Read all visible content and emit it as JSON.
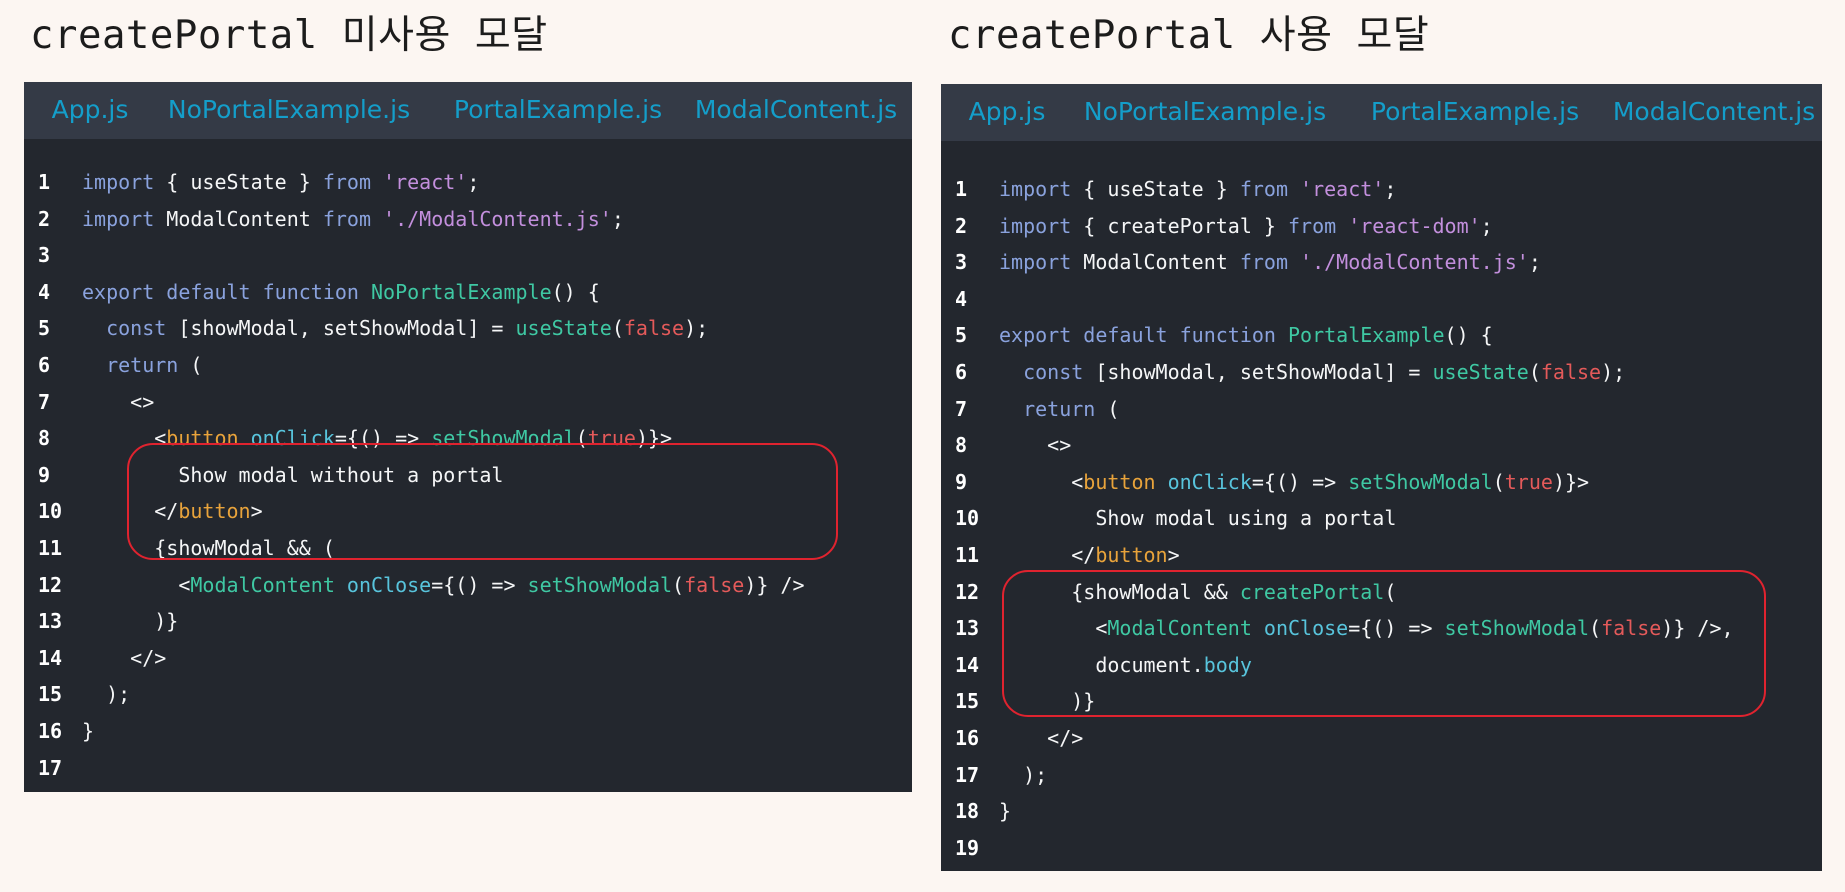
{
  "left": {
    "heading": "createPortal 미사용 모달",
    "tabs": [
      {
        "label": "App.js",
        "active": false
      },
      {
        "label": "NoPortalExample.js",
        "active": true
      },
      {
        "label": "PortalExample.js",
        "active": false
      },
      {
        "label": "ModalContent.js",
        "active": false
      }
    ],
    "lines": [
      {
        "n": "1",
        "tokens": [
          [
            "k",
            "import"
          ],
          [
            "p",
            " { useState } "
          ],
          [
            "k",
            "from"
          ],
          [
            "p",
            " "
          ],
          [
            "s",
            "'react'"
          ],
          [
            "p",
            ";"
          ]
        ]
      },
      {
        "n": "2",
        "tokens": [
          [
            "k",
            "import"
          ],
          [
            "p",
            " ModalContent "
          ],
          [
            "k",
            "from"
          ],
          [
            "p",
            " "
          ],
          [
            "s",
            "'./ModalContent.js'"
          ],
          [
            "p",
            ";"
          ]
        ]
      },
      {
        "n": "3",
        "tokens": []
      },
      {
        "n": "4",
        "tokens": [
          [
            "k",
            "export default function"
          ],
          [
            "p",
            " "
          ],
          [
            "fn",
            "NoPortalExample"
          ],
          [
            "p",
            "() {"
          ]
        ]
      },
      {
        "n": "5",
        "tokens": [
          [
            "p",
            "  "
          ],
          [
            "k",
            "const"
          ],
          [
            "p",
            " [showModal, setShowModal] = "
          ],
          [
            "fn",
            "useState"
          ],
          [
            "p",
            "("
          ],
          [
            "b",
            "false"
          ],
          [
            "p",
            ");"
          ]
        ]
      },
      {
        "n": "6",
        "tokens": [
          [
            "p",
            "  "
          ],
          [
            "k",
            "return"
          ],
          [
            "p",
            " ("
          ]
        ]
      },
      {
        "n": "7",
        "tokens": [
          [
            "p",
            "    <>"
          ]
        ]
      },
      {
        "n": "8",
        "tokens": [
          [
            "p",
            "      <"
          ],
          [
            "t",
            "button"
          ],
          [
            "p",
            " "
          ],
          [
            "a",
            "onClick"
          ],
          [
            "p",
            "={() => "
          ],
          [
            "fn",
            "setShowModal"
          ],
          [
            "p",
            "("
          ],
          [
            "b",
            "true"
          ],
          [
            "p",
            ")}>"
          ]
        ]
      },
      {
        "n": "9",
        "tokens": [
          [
            "p",
            "        Show modal without a portal"
          ]
        ]
      },
      {
        "n": "10",
        "tokens": [
          [
            "p",
            "      </"
          ],
          [
            "t",
            "button"
          ],
          [
            "p",
            ">"
          ]
        ]
      },
      {
        "n": "11",
        "tokens": [
          [
            "p",
            "      {showModal && ("
          ]
        ]
      },
      {
        "n": "12",
        "tokens": [
          [
            "p",
            "        <"
          ],
          [
            "fn",
            "ModalContent"
          ],
          [
            "p",
            " "
          ],
          [
            "a",
            "onClose"
          ],
          [
            "p",
            "={() => "
          ],
          [
            "fn",
            "setShowModal"
          ],
          [
            "p",
            "("
          ],
          [
            "b",
            "false"
          ],
          [
            "p",
            ")} />"
          ]
        ]
      },
      {
        "n": "13",
        "tokens": [
          [
            "p",
            "      )}"
          ]
        ]
      },
      {
        "n": "14",
        "tokens": [
          [
            "p",
            "    </>"
          ]
        ]
      },
      {
        "n": "15",
        "tokens": [
          [
            "p",
            "  );"
          ]
        ]
      },
      {
        "n": "16",
        "tokens": [
          [
            "p",
            "}"
          ]
        ]
      },
      {
        "n": "17",
        "tokens": []
      }
    ]
  },
  "right": {
    "heading": "createPortal 사용 모달",
    "tabs": [
      {
        "label": "App.js",
        "active": false
      },
      {
        "label": "NoPortalExample.js",
        "active": false
      },
      {
        "label": "PortalExample.js",
        "active": true
      },
      {
        "label": "ModalContent.js",
        "active": false
      }
    ],
    "lines": [
      {
        "n": "1",
        "tokens": [
          [
            "k",
            "import"
          ],
          [
            "p",
            " { useState } "
          ],
          [
            "k",
            "from"
          ],
          [
            "p",
            " "
          ],
          [
            "s",
            "'react'"
          ],
          [
            "p",
            ";"
          ]
        ]
      },
      {
        "n": "2",
        "tokens": [
          [
            "k",
            "import"
          ],
          [
            "p",
            " { createPortal } "
          ],
          [
            "k",
            "from"
          ],
          [
            "p",
            " "
          ],
          [
            "s",
            "'react-dom'"
          ],
          [
            "p",
            ";"
          ]
        ]
      },
      {
        "n": "3",
        "tokens": [
          [
            "k",
            "import"
          ],
          [
            "p",
            " ModalContent "
          ],
          [
            "k",
            "from"
          ],
          [
            "p",
            " "
          ],
          [
            "s",
            "'./ModalContent.js'"
          ],
          [
            "p",
            ";"
          ]
        ]
      },
      {
        "n": "4",
        "tokens": []
      },
      {
        "n": "5",
        "tokens": [
          [
            "k",
            "export default function"
          ],
          [
            "p",
            " "
          ],
          [
            "fn",
            "PortalExample"
          ],
          [
            "p",
            "() {"
          ]
        ]
      },
      {
        "n": "6",
        "tokens": [
          [
            "p",
            "  "
          ],
          [
            "k",
            "const"
          ],
          [
            "p",
            " [showModal, setShowModal] = "
          ],
          [
            "fn",
            "useState"
          ],
          [
            "p",
            "("
          ],
          [
            "b",
            "false"
          ],
          [
            "p",
            ");"
          ]
        ]
      },
      {
        "n": "7",
        "tokens": [
          [
            "p",
            "  "
          ],
          [
            "k",
            "return"
          ],
          [
            "p",
            " ("
          ]
        ]
      },
      {
        "n": "8",
        "tokens": [
          [
            "p",
            "    <>"
          ]
        ]
      },
      {
        "n": "9",
        "tokens": [
          [
            "p",
            "      <"
          ],
          [
            "t",
            "button"
          ],
          [
            "p",
            " "
          ],
          [
            "a",
            "onClick"
          ],
          [
            "p",
            "={() => "
          ],
          [
            "fn",
            "setShowModal"
          ],
          [
            "p",
            "("
          ],
          [
            "b",
            "true"
          ],
          [
            "p",
            ")}>"
          ]
        ]
      },
      {
        "n": "10",
        "tokens": [
          [
            "p",
            "        Show modal using a portal"
          ]
        ]
      },
      {
        "n": "11",
        "tokens": [
          [
            "p",
            "      </"
          ],
          [
            "t",
            "button"
          ],
          [
            "p",
            ">"
          ]
        ]
      },
      {
        "n": "12",
        "tokens": [
          [
            "p",
            "      {showModal && "
          ],
          [
            "fn",
            "createPortal"
          ],
          [
            "p",
            "("
          ]
        ]
      },
      {
        "n": "13",
        "tokens": [
          [
            "p",
            "        <"
          ],
          [
            "fn",
            "ModalContent"
          ],
          [
            "p",
            " "
          ],
          [
            "a",
            "onClose"
          ],
          [
            "p",
            "={() => "
          ],
          [
            "fn",
            "setShowModal"
          ],
          [
            "p",
            "("
          ],
          [
            "b",
            "false"
          ],
          [
            "p",
            ")} />,"
          ]
        ]
      },
      {
        "n": "14",
        "tokens": [
          [
            "p",
            "        document."
          ],
          [
            "a",
            "body"
          ]
        ]
      },
      {
        "n": "15",
        "tokens": [
          [
            "p",
            "      )}"
          ]
        ]
      },
      {
        "n": "16",
        "tokens": [
          [
            "p",
            "    </>"
          ]
        ]
      },
      {
        "n": "17",
        "tokens": [
          [
            "p",
            "  );"
          ]
        ]
      },
      {
        "n": "18",
        "tokens": [
          [
            "p",
            "}"
          ]
        ]
      },
      {
        "n": "19",
        "tokens": []
      }
    ]
  },
  "colors": {
    "page_bg": "#fcf6f2",
    "editor_bg": "#23272e",
    "tabbar_bg": "#343a46",
    "tab_text": "#149eca",
    "highlight_border": "#e0232f"
  }
}
